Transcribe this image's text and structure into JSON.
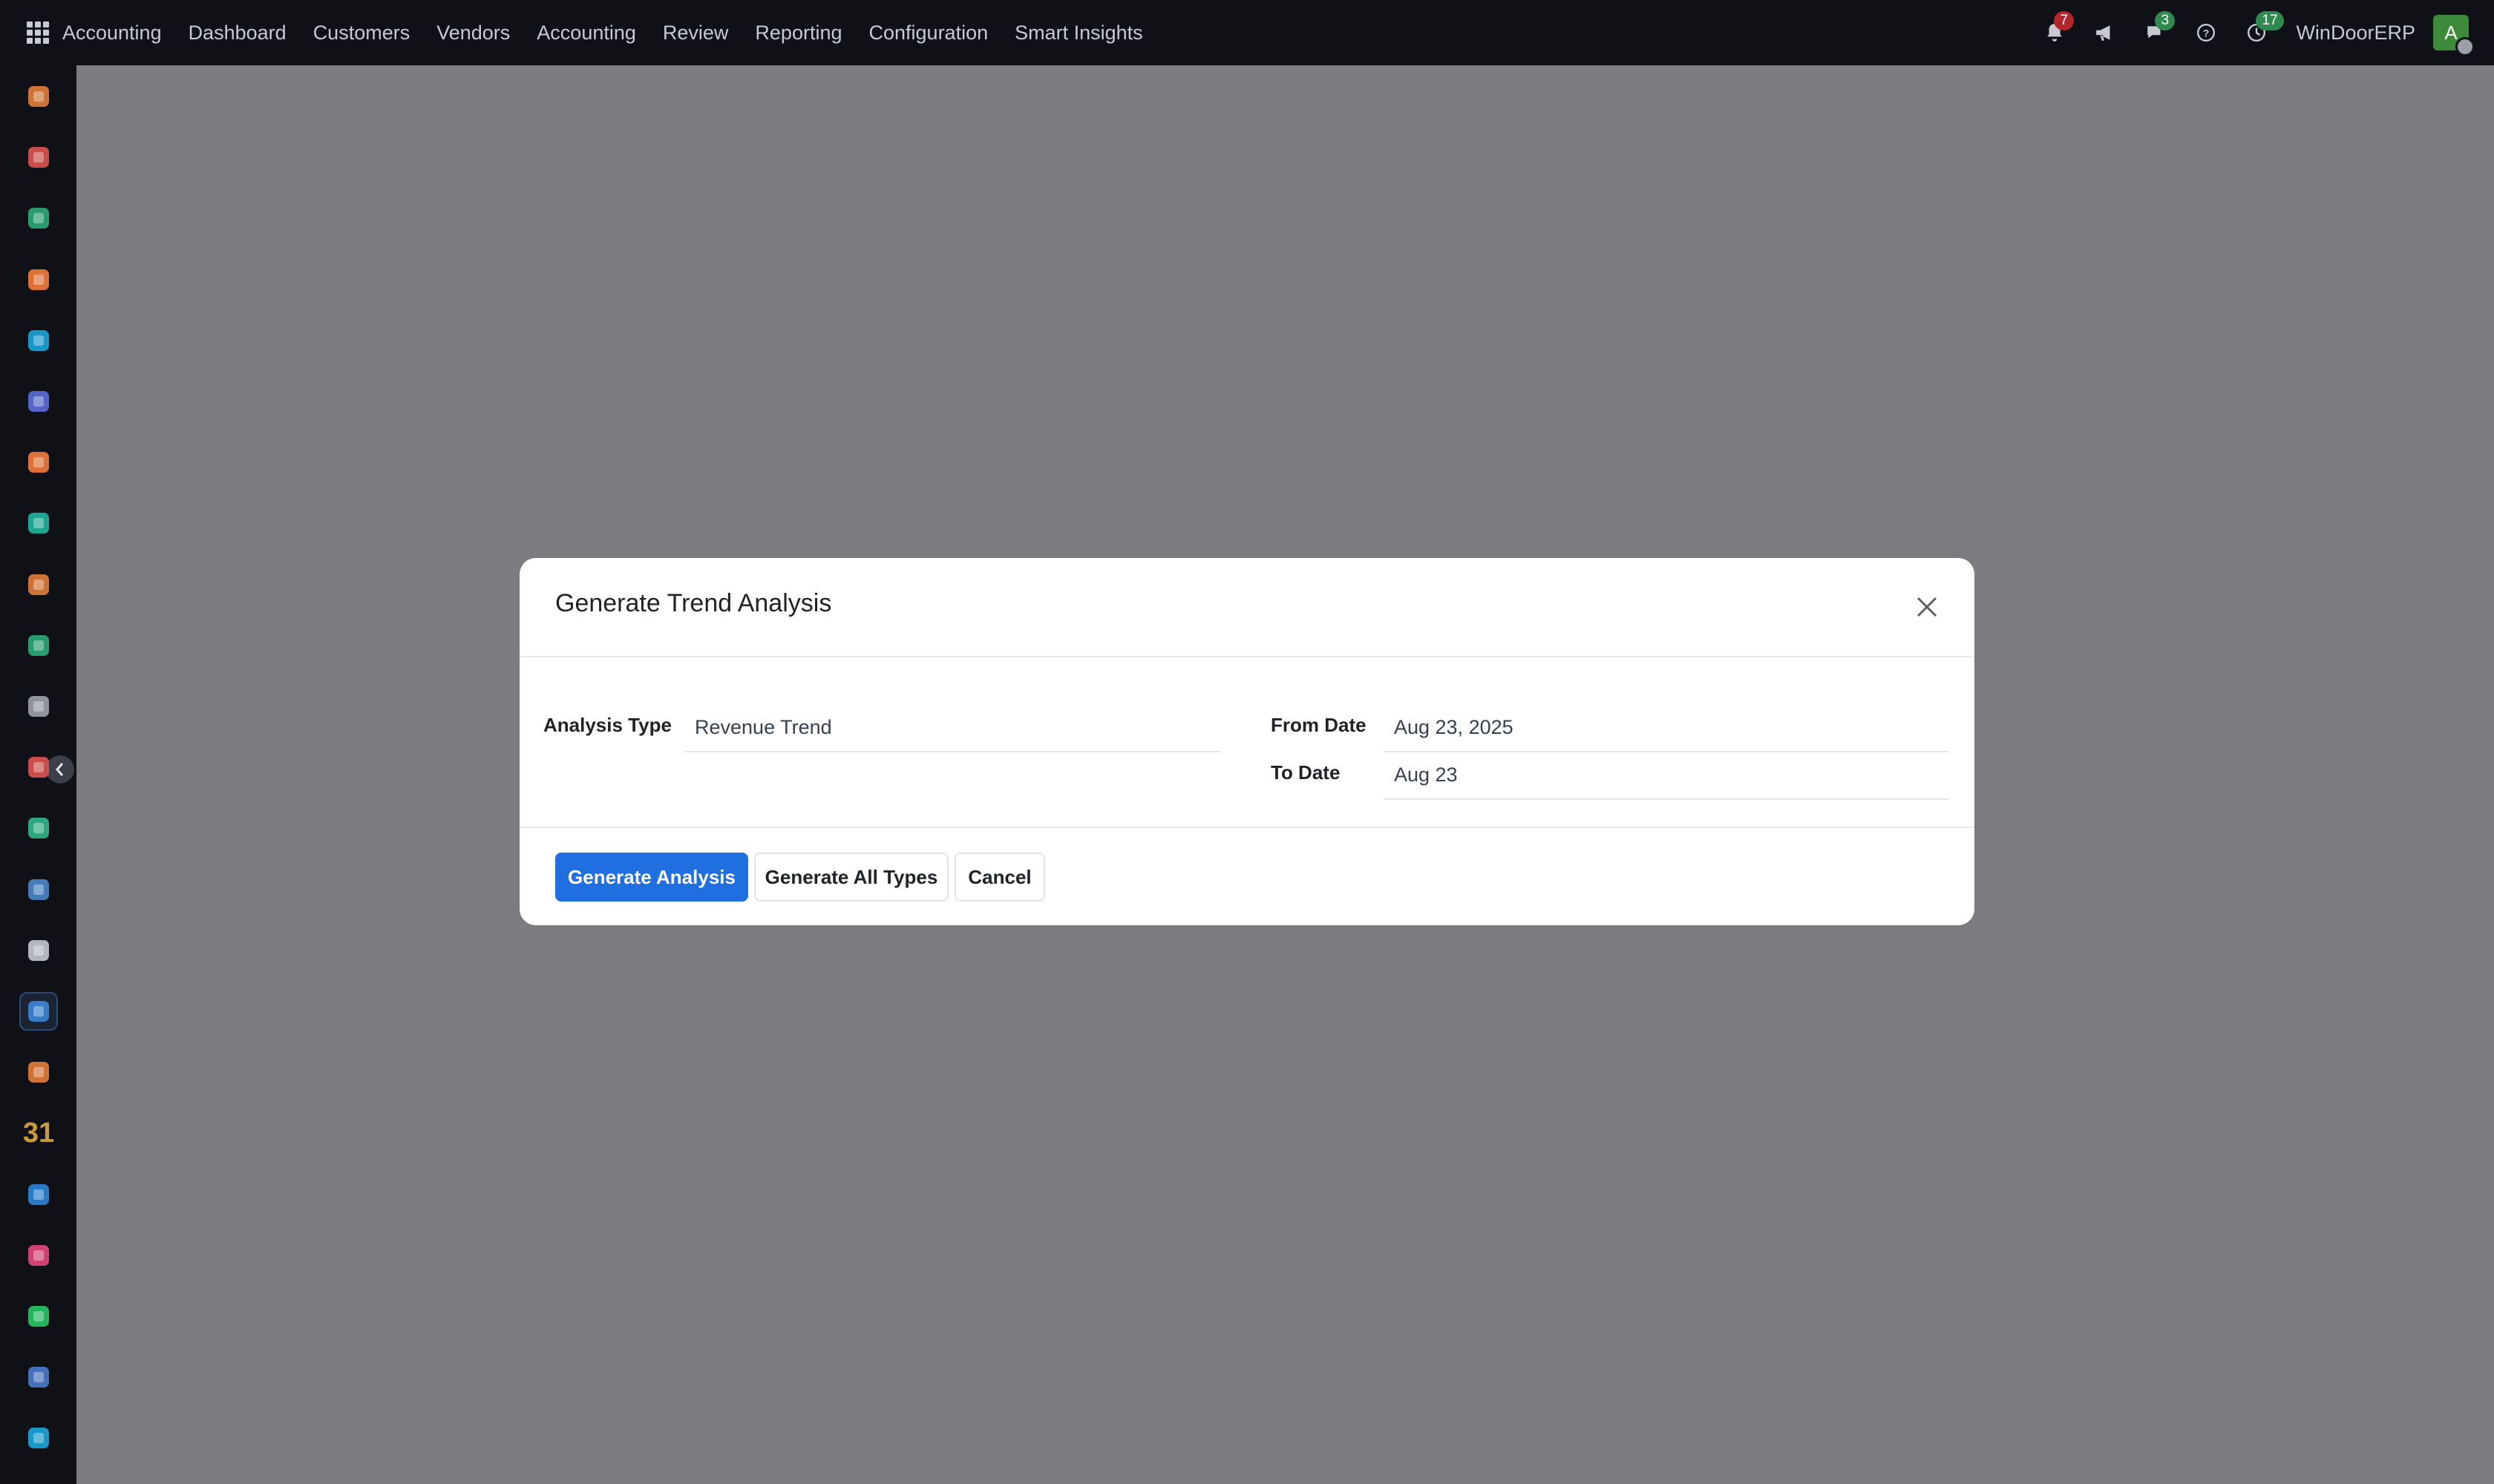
{
  "topbar": {
    "brand": "Accounting",
    "menu": [
      "Dashboard",
      "Customers",
      "Vendors",
      "Accounting",
      "Review",
      "Reporting",
      "Configuration",
      "Smart Insights"
    ],
    "icons": [
      {
        "name": "bell-icon",
        "badge": "7",
        "badge_color": "#b3262b"
      },
      {
        "name": "megaphone-icon",
        "badge": "",
        "badge_color": ""
      },
      {
        "name": "chat-icon",
        "badge": "3",
        "badge_color": "#2f8a4f"
      },
      {
        "name": "help-icon",
        "badge": "",
        "badge_color": ""
      },
      {
        "name": "activity-clock-icon",
        "badge": "17",
        "badge_color": "#2f8a4f"
      }
    ],
    "company": "WinDoorERP",
    "avatar_initial": "A"
  },
  "sidebar": {
    "items": [
      {
        "name": "bar-chart-icon",
        "color": "#e07b39"
      },
      {
        "name": "puzzle-icon",
        "color": "#d9534f"
      },
      {
        "name": "contact-icon",
        "color": "#2aa876"
      },
      {
        "name": "chat-bubble-icon",
        "color": "#f0783c"
      },
      {
        "name": "globe-icon",
        "color": "#1aa3d9"
      },
      {
        "name": "mail-icon",
        "color": "#5b6bd6"
      },
      {
        "name": "chat-bubble-icon",
        "color": "#f0783c"
      },
      {
        "name": "check-folder-icon",
        "color": "#1fb3a0"
      },
      {
        "name": "bar-chart-icon",
        "color": "#e07b39"
      },
      {
        "name": "contact-icon",
        "color": "#2aa876"
      },
      {
        "name": "cube-icon",
        "color": "#9ba1a8"
      },
      {
        "name": "puzzle-icon",
        "color": "#d9534f"
      },
      {
        "name": "checkmark-icon",
        "color": "#2fb58a"
      },
      {
        "name": "book-icon",
        "color": "#4b84c9"
      },
      {
        "name": "package-icon",
        "color": "#c0c5cc"
      },
      {
        "name": "document-icon",
        "color": "#3a86d6",
        "active": true
      },
      {
        "name": "team-icon",
        "color": "#e07b39"
      },
      {
        "name": "calendar-31-icon",
        "color": "#c79a3a",
        "text": "31"
      },
      {
        "name": "pen-icon",
        "color": "#2a83d9"
      },
      {
        "name": "dashboard-grid-icon",
        "color": "#e0467b"
      },
      {
        "name": "whatsapp-icon",
        "color": "#25c466"
      },
      {
        "name": "dial-icon",
        "color": "#4a78c9"
      },
      {
        "name": "globe-icon",
        "color": "#1aa3d9"
      }
    ]
  },
  "dialog": {
    "title": "Generate Trend Analysis",
    "analysis_type_label": "Analysis Type",
    "analysis_type_value": "Revenue Trend",
    "from_date_label": "From Date",
    "from_date_value": "Aug 23, 2025",
    "to_date_label": "To Date",
    "to_date_value": "Aug 23",
    "buttons": {
      "generate": "Generate Analysis",
      "generate_all": "Generate All Types",
      "cancel": "Cancel"
    }
  }
}
